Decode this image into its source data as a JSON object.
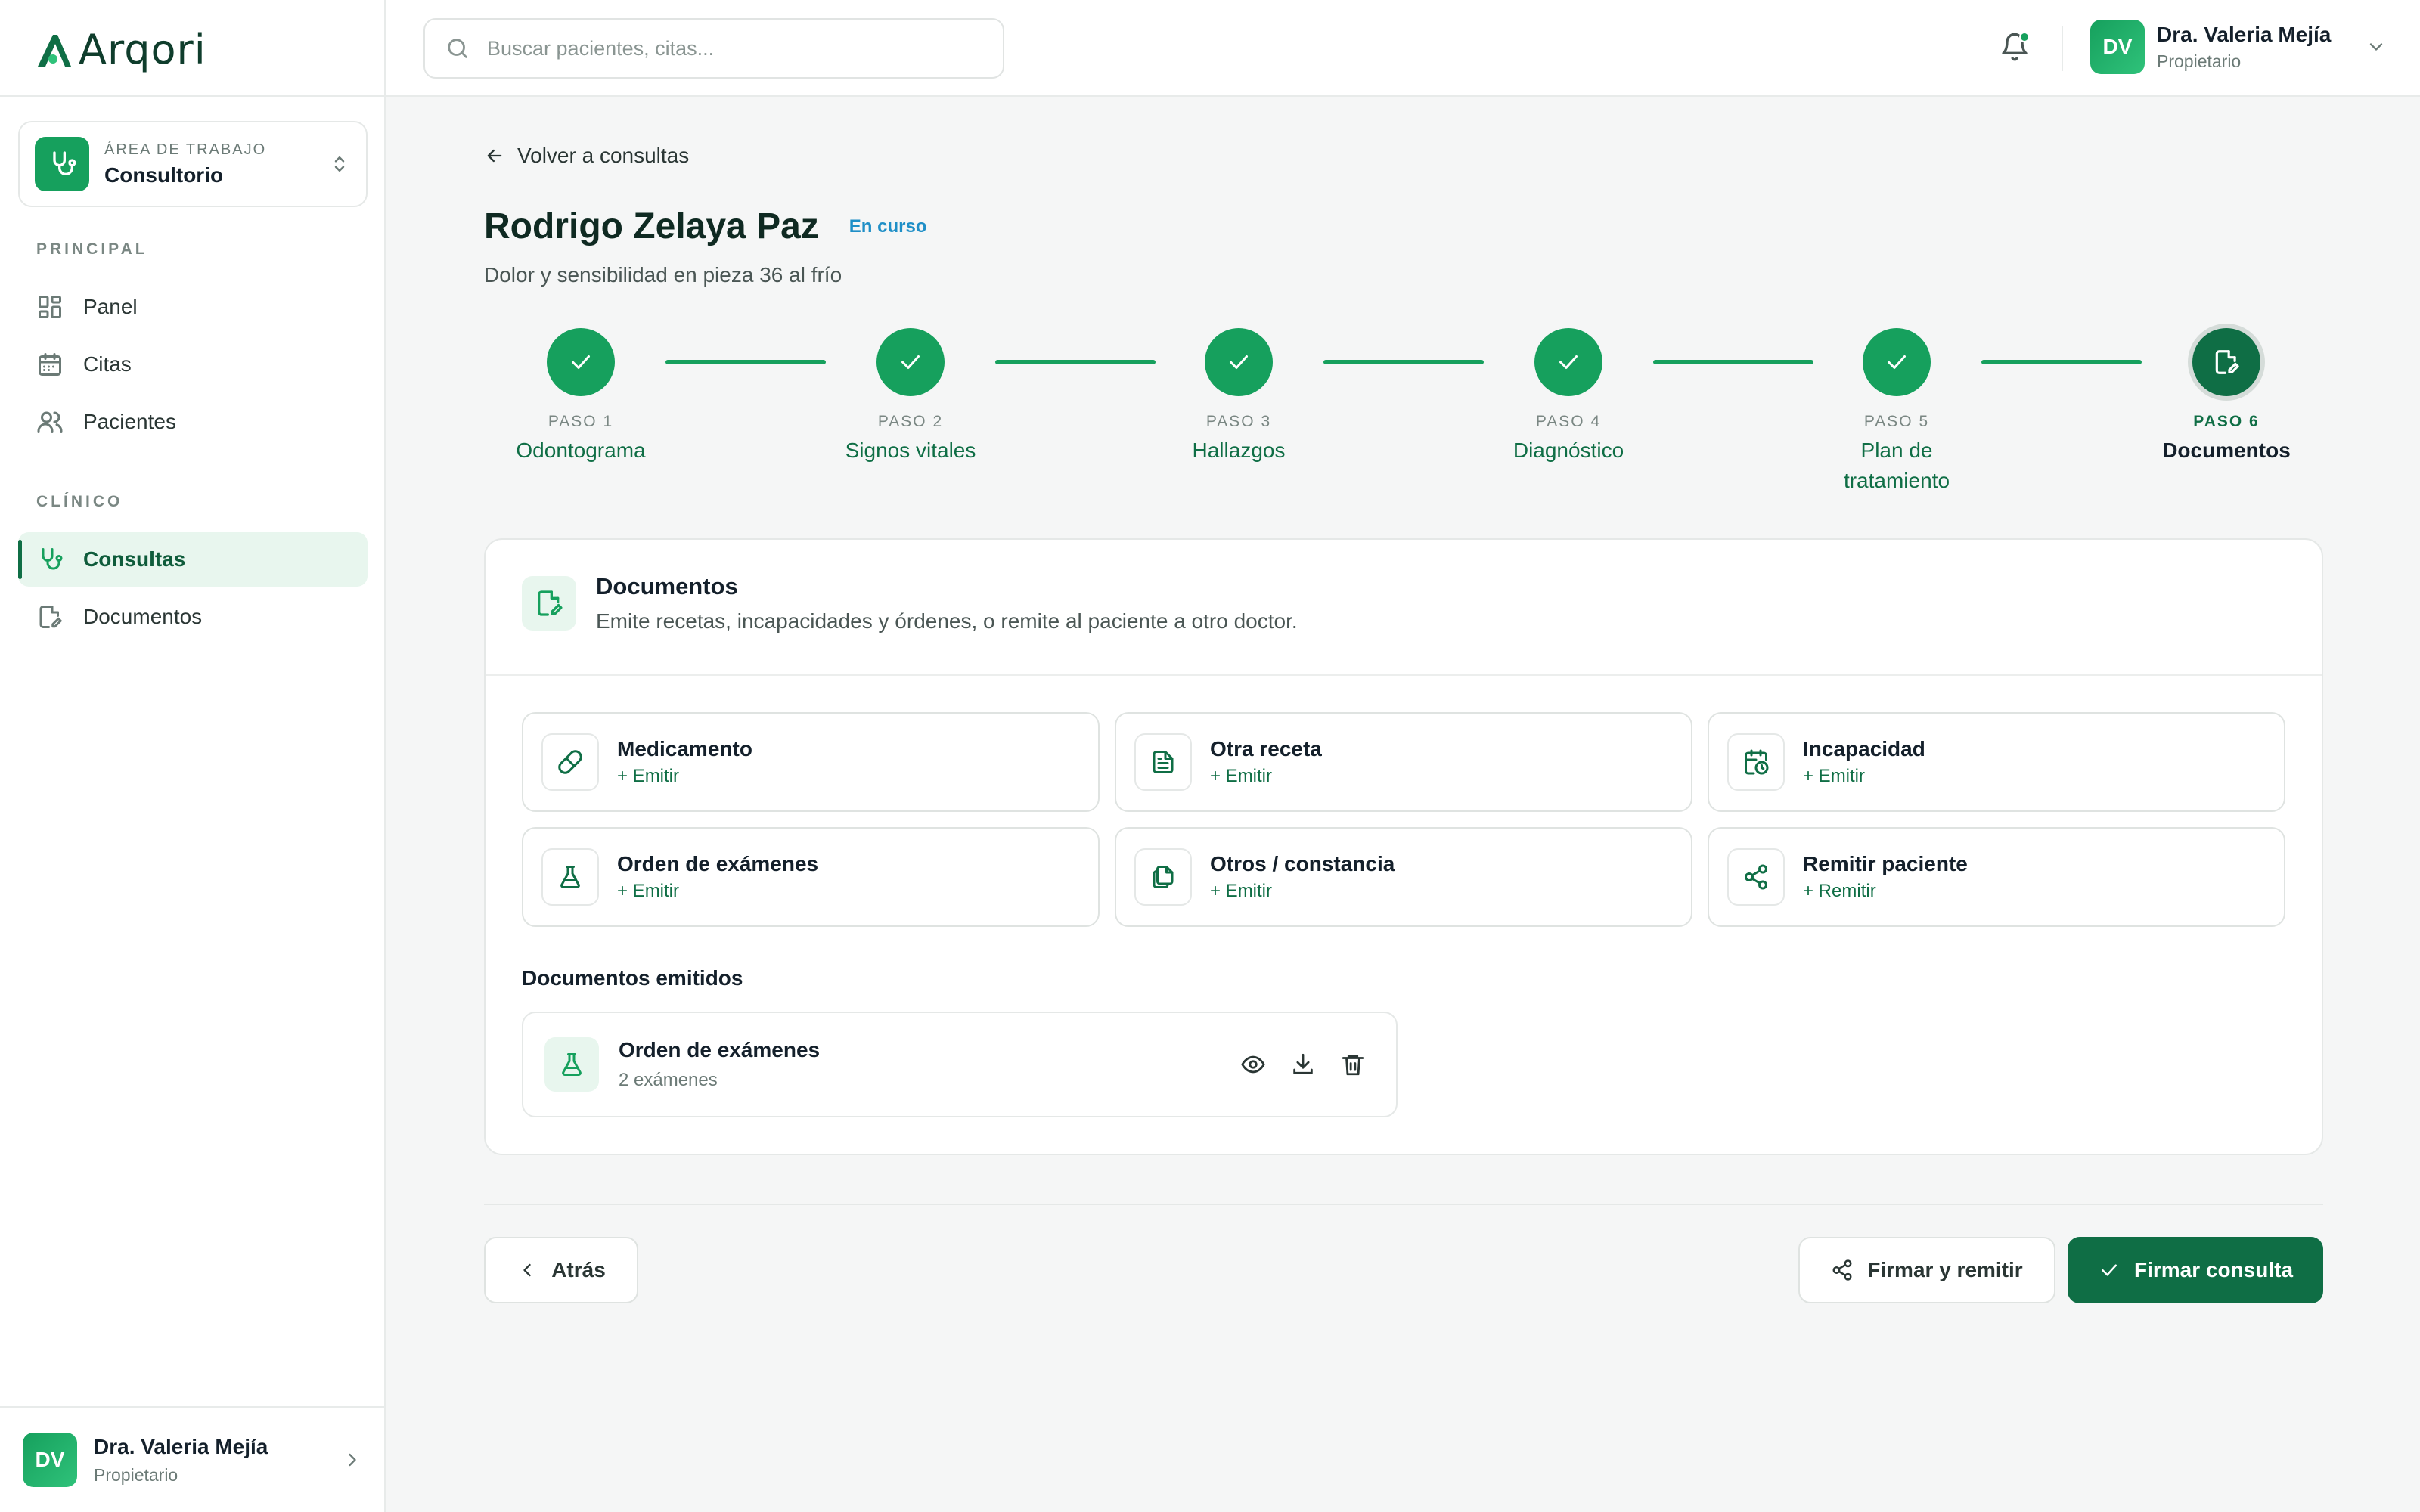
{
  "app": {
    "name": "Arqori"
  },
  "colors": {
    "accent": "#16a05d",
    "accent_dark": "#0f6e45",
    "status_blue": "#1f8fc7"
  },
  "sidebar": {
    "workspace": {
      "label": "ÁREA DE TRABAJO",
      "value": "Consultorio",
      "icon": "stethoscope-icon"
    },
    "sections": [
      {
        "label": "PRINCIPAL",
        "items": [
          {
            "label": "Panel",
            "icon": "grid-icon"
          },
          {
            "label": "Citas",
            "icon": "calendar-icon"
          },
          {
            "label": "Pacientes",
            "icon": "users-icon"
          }
        ]
      },
      {
        "label": "CLÍNICO",
        "items": [
          {
            "label": "Consultas",
            "icon": "stethoscope-icon",
            "active": true
          },
          {
            "label": "Documentos",
            "icon": "document-edit-icon"
          }
        ]
      }
    ],
    "user": {
      "initials": "DV",
      "name": "Dra. Valeria Mejía",
      "role": "Propietario"
    }
  },
  "topbar": {
    "search_placeholder": "Buscar pacientes, citas...",
    "user": {
      "initials": "DV",
      "name": "Dra. Valeria Mejía",
      "role": "Propietario"
    }
  },
  "main": {
    "back_label": "Volver a consultas",
    "patient_name": "Rodrigo Zelaya Paz",
    "status": "En curso",
    "complaint": "Dolor y sensibilidad en pieza 36 al frío",
    "steps": [
      {
        "num": "PASO 1",
        "title": "Odontograma",
        "state": "done"
      },
      {
        "num": "PASO 2",
        "title": "Signos vitales",
        "state": "done"
      },
      {
        "num": "PASO 3",
        "title": "Hallazgos",
        "state": "done"
      },
      {
        "num": "PASO 4",
        "title": "Diagnóstico",
        "state": "done"
      },
      {
        "num": "PASO 5",
        "title": "Plan de tratamiento",
        "state": "done"
      },
      {
        "num": "PASO 6",
        "title": "Documentos",
        "state": "current"
      }
    ],
    "card": {
      "title": "Documentos",
      "subtitle": "Emite recetas, incapacidades y órdenes, o remite al paciente a otro doctor.",
      "options": [
        {
          "title": "Medicamento",
          "action": "+ Emitir",
          "icon": "pill-icon"
        },
        {
          "title": "Otra receta",
          "action": "+ Emitir",
          "icon": "file-text-icon"
        },
        {
          "title": "Incapacidad",
          "action": "+ Emitir",
          "icon": "calendar-clock-icon"
        },
        {
          "title": "Orden de exámenes",
          "action": "+ Emitir",
          "icon": "flask-icon"
        },
        {
          "title": "Otros / constancia",
          "action": "+ Emitir",
          "icon": "copy-icon"
        },
        {
          "title": "Remitir paciente",
          "action": "+ Remitir",
          "icon": "share-icon"
        }
      ],
      "emitted_label": "Documentos emitidos",
      "emitted": [
        {
          "title": "Orden de exámenes",
          "subtitle": "2 exámenes",
          "icon": "flask-icon"
        }
      ]
    },
    "footer": {
      "back_button": "Atrás",
      "sign_refer_button": "Firmar y remitir",
      "sign_button": "Firmar consulta"
    }
  }
}
